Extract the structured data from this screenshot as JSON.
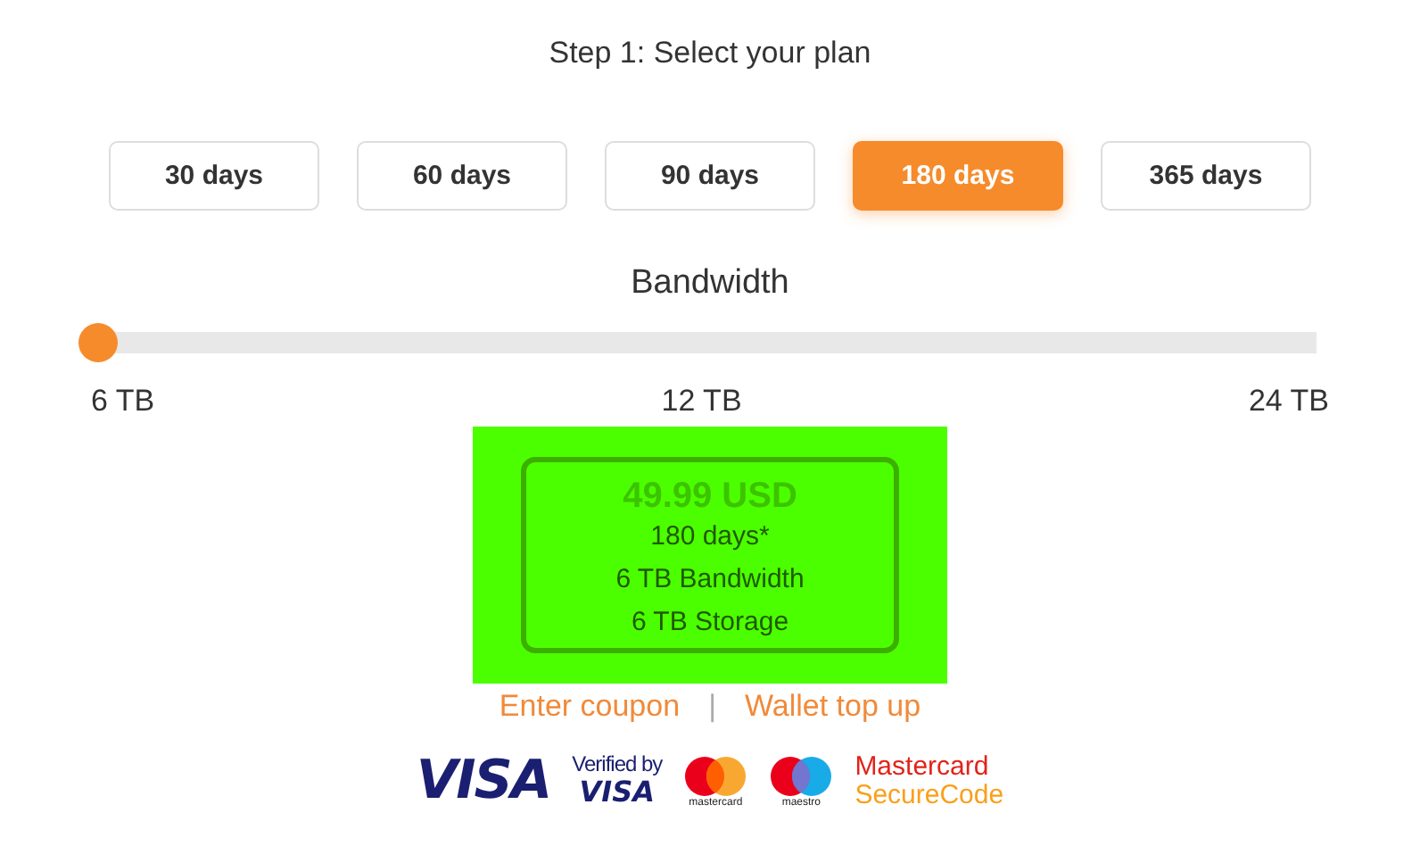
{
  "title": "Step 1: Select your plan",
  "plans": [
    {
      "label": "30 days",
      "selected": false
    },
    {
      "label": "60 days",
      "selected": false
    },
    {
      "label": "90 days",
      "selected": false
    },
    {
      "label": "180 days",
      "selected": true
    },
    {
      "label": "365 days",
      "selected": false
    }
  ],
  "bandwidth": {
    "label": "Bandwidth",
    "level": 0,
    "ticks": [
      "6 TB",
      "12 TB",
      "24 TB"
    ]
  },
  "summary": {
    "price": "49.99 USD",
    "lines": [
      "180 days*",
      "6 TB Bandwidth",
      "6 TB Storage"
    ]
  },
  "links": [
    "Enter coupon",
    "Wallet top up"
  ],
  "separator": "|",
  "payment_logos": [
    {
      "kind": "visa",
      "text": "VISA"
    },
    {
      "kind": "verified",
      "text": "Verified by",
      "text2": "VISA"
    },
    {
      "kind": "mastercard",
      "text": "mastercard"
    },
    {
      "kind": "maestro",
      "text": "maestro"
    },
    {
      "kind": "securecode",
      "text": "Mastercard",
      "text2": "SecureCode"
    }
  ]
}
